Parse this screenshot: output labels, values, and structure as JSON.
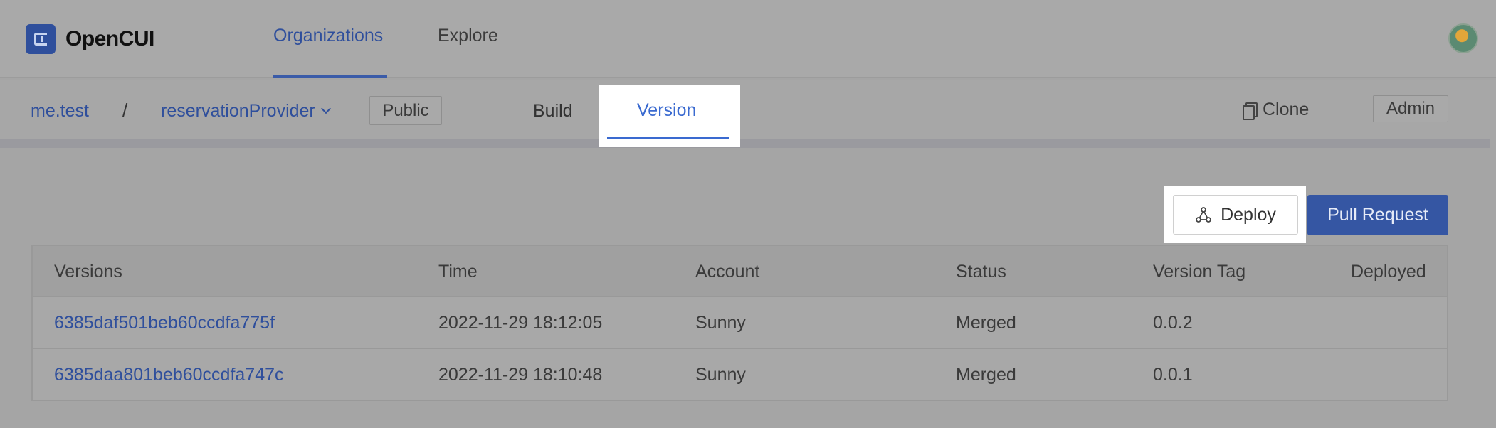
{
  "app": {
    "logo_text": "OpenCUI",
    "nav": [
      {
        "label": "Organizations",
        "active": true
      },
      {
        "label": "Explore",
        "active": false
      }
    ]
  },
  "subheader": {
    "org": "me.test",
    "separator": "/",
    "project": "reservationProvider",
    "visibility": "Public",
    "tabs": [
      {
        "label": "Build",
        "active": false
      },
      {
        "label": "Version",
        "active": true
      }
    ],
    "clone_label": "Clone",
    "admin_label": "Admin"
  },
  "actions": {
    "deploy_label": "Deploy",
    "pull_request_label": "Pull Request"
  },
  "table": {
    "headers": [
      "Versions",
      "Time",
      "Account",
      "Status",
      "Version Tag",
      "Deployed"
    ],
    "rows": [
      [
        "6385daf501beb60ccdfa775f",
        "2022-11-29 18:12:05",
        "Sunny",
        "Merged",
        "0.0.2",
        ""
      ],
      [
        "6385daa801beb60ccdfa747c",
        "2022-11-29 18:10:48",
        "Sunny",
        "Merged",
        "0.0.1",
        ""
      ]
    ]
  },
  "colors": {
    "accent": "#2f4f9c",
    "highlight_tab": "#3a6ad0",
    "primary_button": "#3556a3",
    "overlay": "#a5a5a5"
  },
  "icons": [
    "logo-icon",
    "chevron-down-icon",
    "clone-icon",
    "deploy-icon",
    "avatar"
  ]
}
